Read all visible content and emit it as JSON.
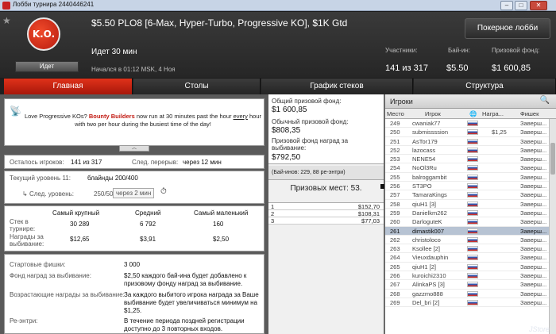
{
  "window": {
    "title": "Лобби турнира 2440446241",
    "min": "–",
    "max": "□",
    "close": "✕"
  },
  "header": {
    "logo_text": "K.O.",
    "status": "Идет",
    "title": "$5.50 PLO8 [6-Max, Hyper-Turbo, Progressive KO], $1K Gtd",
    "elapsed": "Идет 30 мин",
    "started": "Начался в 01:12 MSK, 4 Ноя",
    "lobby_button": "Покерное лобби",
    "stats": [
      {
        "label": "Участники:",
        "value": "141 из 317"
      },
      {
        "label": "Бай-ин:",
        "value": "$5.50"
      },
      {
        "label": "Призовой фонд:",
        "value": "$1 600,85"
      }
    ]
  },
  "tabs": [
    "Главная",
    "Столы",
    "График стеков",
    "Структура"
  ],
  "promo": {
    "part1": "Love Progressive KOs? ",
    "bounty": "Bounty Builders",
    "part2": " now run at 30 minutes past the hour ",
    "every": "every",
    "part3": " hour with two per hour during the busiest time of the day!"
  },
  "remaining": {
    "label": "Осталось игроков:",
    "value": "141 из 317",
    "break_label": "След. перерыв:",
    "break_value": "через 12 мин"
  },
  "level": {
    "current_label": "Текущий уровень 11:",
    "current_value": "блайнды 200/400",
    "next_label": "След. уровень:",
    "next_value": "250/500",
    "next_time": "через 2 мин"
  },
  "stacks": {
    "headers": [
      "Самый крупный",
      "Средний",
      "Самый маленький"
    ],
    "stack_label": "Стек в турнире:",
    "stack_values": [
      "30 289",
      "6 792",
      "160"
    ],
    "bounty_label": "Награды за выбивание:",
    "bounty_values": [
      "$12,65",
      "$3,91",
      "$2,50"
    ]
  },
  "info": [
    {
      "label": "Стартовые фишки:",
      "value": "3 000"
    },
    {
      "label": "Фонд наград за выбивание:",
      "value": "$2,50 каждого бай-ина будет добавлено к призовому фонду наград за выбивание."
    },
    {
      "label": "Возрастающие награды за выбивание:",
      "value": "За каждого выбитого игрока награда за Ваше выбивание будет увеличиваться минимум на $1,25."
    },
    {
      "label": "Ре-энтри:",
      "value": "В течение периода поздней регистрации доступно до 3 повторных входов."
    }
  ],
  "prize": {
    "total_label": "Общий призовой фонд:",
    "total_value": "$1 600,85",
    "regular_label": "Обычный призовой фонд:",
    "regular_value": "$808,35",
    "bounty_label": "Призовой фонд наград за выбивание:",
    "bounty_value": "$792,50",
    "buyins": "(Бай-инов: 229, 88 ре-энтри)",
    "places_title": "Призовых мест: 53.",
    "payouts": [
      {
        "place": "1",
        "amount": "$152,70"
      },
      {
        "place": "2",
        "amount": "$108,31"
      },
      {
        "place": "3",
        "amount": "$77,03"
      }
    ]
  },
  "players": {
    "title": "Игроки",
    "columns": [
      "Место",
      "Игрок",
      "",
      "Награ...",
      "Фишек"
    ],
    "rows": [
      {
        "place": "249",
        "name": "cwaniak77",
        "bounty": "",
        "chips": "Заверш..."
      },
      {
        "place": "250",
        "name": "submissssion",
        "bounty": "$1,25",
        "chips": "Заверш..."
      },
      {
        "place": "251",
        "name": "AsTor179",
        "bounty": "",
        "chips": "Заверш..."
      },
      {
        "place": "252",
        "name": "lazocass",
        "bounty": "",
        "chips": "Заверш..."
      },
      {
        "place": "253",
        "name": "NENE54",
        "bounty": "",
        "chips": "Заверш..."
      },
      {
        "place": "254",
        "name": "NoOl3Ru",
        "bounty": "",
        "chips": "Заверш..."
      },
      {
        "place": "255",
        "name": "balroggambit",
        "bounty": "",
        "chips": "Заверш..."
      },
      {
        "place": "256",
        "name": "ST3PO",
        "bounty": "",
        "chips": "Заверш..."
      },
      {
        "place": "257",
        "name": "TamaraKings",
        "bounty": "",
        "chips": "Заверш..."
      },
      {
        "place": "258",
        "name": "qiuH1 [3]",
        "bounty": "",
        "chips": "Заверш..."
      },
      {
        "place": "259",
        "name": "Danielkm262",
        "bounty": "",
        "chips": "Заверш..."
      },
      {
        "place": "260",
        "name": "DarloguteK",
        "bounty": "",
        "chips": "Заверш..."
      },
      {
        "place": "261",
        "name": "dimastik007",
        "bounty": "",
        "chips": "Заверш..."
      },
      {
        "place": "262",
        "name": "christoloco",
        "bounty": "",
        "chips": "Заверш..."
      },
      {
        "place": "263",
        "name": "Ksollee [2]",
        "bounty": "",
        "chips": "Заверш..."
      },
      {
        "place": "264",
        "name": "Vieuxdauphin",
        "bounty": "",
        "chips": "Заверш..."
      },
      {
        "place": "265",
        "name": "qiuH1 [2]",
        "bounty": "",
        "chips": "Заверш..."
      },
      {
        "place": "266",
        "name": "kuroichi2310",
        "bounty": "",
        "chips": "Заверш..."
      },
      {
        "place": "267",
        "name": "AlinkaPS [3]",
        "bounty": "",
        "chips": "Заверш..."
      },
      {
        "place": "268",
        "name": "gazzmo888",
        "bounty": "",
        "chips": "Заверш..."
      },
      {
        "place": "269",
        "name": "Del_bri [2]",
        "bounty": "",
        "chips": "Заверш..."
      }
    ],
    "highlighted_index": 12
  },
  "watermark": "JStore"
}
